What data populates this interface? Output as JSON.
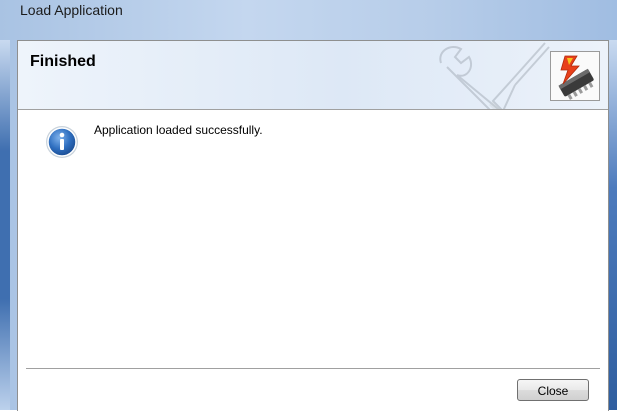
{
  "window": {
    "title": "Load Application"
  },
  "header": {
    "title": "Finished",
    "watermark_icon": "wrench-screwdriver-icon",
    "logo_icon": "chip-lightning-icon"
  },
  "content": {
    "icon": "info-icon",
    "message": "Application loaded successfully."
  },
  "footer": {
    "close_label": "Close"
  },
  "colors": {
    "frame_accent": "#3f6fb0",
    "header_band": "#dde8f6",
    "info_icon_blue": "#2f6fc0",
    "chip_lightning": "#e8401a"
  }
}
